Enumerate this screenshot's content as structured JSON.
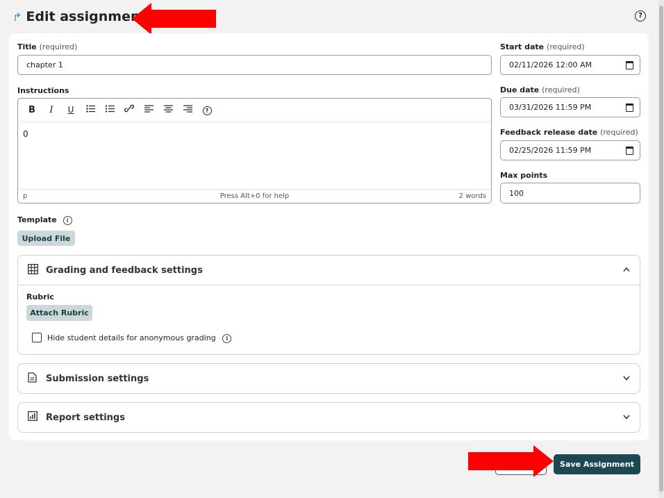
{
  "header": {
    "title": "Edit assignment",
    "help_icon": "question-circle-icon"
  },
  "title_field": {
    "label": "Title",
    "required": "(required)",
    "value": "chapter 1"
  },
  "instructions": {
    "label": "Instructions",
    "toolbar": {
      "bold": "B",
      "italic": "I",
      "underline": "U",
      "help": "?"
    },
    "content": "0",
    "status": {
      "element": "p",
      "hint": "Press Alt+0 for help",
      "word_count": "2 words"
    }
  },
  "start_date": {
    "label": "Start date",
    "required": "(required)",
    "value": "02/11/2026 12:00 AM"
  },
  "due_date": {
    "label": "Due date",
    "required": "(required)",
    "value": "03/31/2026 11:59 PM"
  },
  "feedback_date": {
    "label": "Feedback release date",
    "required": "(required)",
    "value": "02/25/2026 11:59 PM"
  },
  "max_points": {
    "label": "Max points",
    "value": "100"
  },
  "template": {
    "label": "Template",
    "upload_label": "Upload File"
  },
  "grading": {
    "title": "Grading and feedback settings",
    "rubric_label": "Rubric",
    "attach_label": "Attach Rubric",
    "anonymous_label": "Hide student details for anonymous grading",
    "anonymous_checked": false
  },
  "submission": {
    "title": "Submission settings"
  },
  "report": {
    "title": "Report settings"
  },
  "footer": {
    "save_label": "Save Assignment"
  },
  "colors": {
    "accent": "#1c4852",
    "soft_button": "#c9d9da",
    "annotation_arrow": "#ff0000"
  }
}
